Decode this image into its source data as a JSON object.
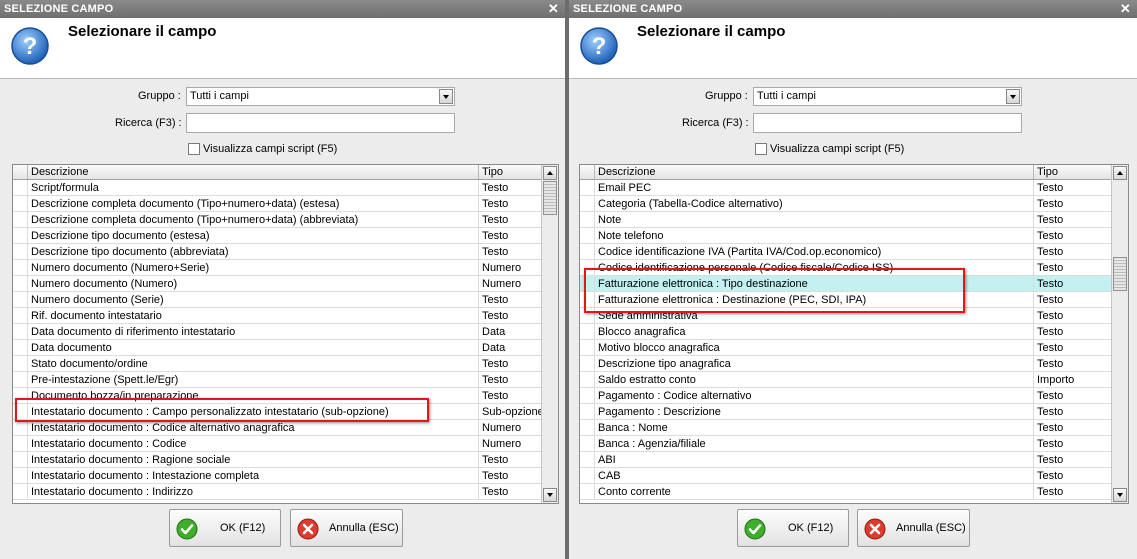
{
  "dialog_left": {
    "title": "SELEZIONE CAMPO",
    "heading": "Selezionare il campo",
    "gruppo_label": "Gruppo :",
    "gruppo_value": "Tutti i campi",
    "ricerca_label": "Ricerca (F3) :",
    "ricerca_value": "",
    "script_checkbox_label": "Visualizza campi script (F5)",
    "columns": {
      "descrizione": "Descrizione",
      "tipo": "Tipo"
    },
    "rows": [
      {
        "d": "Script/formula",
        "t": "Testo"
      },
      {
        "d": "Descrizione completa documento (Tipo+numero+data) (estesa)",
        "t": "Testo"
      },
      {
        "d": "Descrizione completa documento (Tipo+numero+data) (abbreviata)",
        "t": "Testo"
      },
      {
        "d": "Descrizione tipo documento (estesa)",
        "t": "Testo"
      },
      {
        "d": "Descrizione tipo documento (abbreviata)",
        "t": "Testo"
      },
      {
        "d": "Numero documento (Numero+Serie)",
        "t": "Numero"
      },
      {
        "d": "Numero documento (Numero)",
        "t": "Numero"
      },
      {
        "d": "Numero documento (Serie)",
        "t": "Testo"
      },
      {
        "d": "Rif. documento intestatario",
        "t": "Testo"
      },
      {
        "d": "Data documento di riferimento intestatario",
        "t": "Data"
      },
      {
        "d": "Data documento",
        "t": "Data"
      },
      {
        "d": "Stato documento/ordine",
        "t": "Testo"
      },
      {
        "d": "Pre-intestazione (Spett.le/Egr)",
        "t": "Testo"
      },
      {
        "d": "Documento bozza/in preparazione",
        "t": "Testo"
      },
      {
        "d": "Intestatario documento : Campo personalizzato intestatario (sub-opzione)",
        "t": "Sub-opzione"
      },
      {
        "d": "Intestatario documento : Codice alternativo anagrafica",
        "t": "Numero"
      },
      {
        "d": "Intestatario documento : Codice",
        "t": "Numero"
      },
      {
        "d": "Intestatario documento : Ragione sociale",
        "t": "Testo"
      },
      {
        "d": "Intestatario documento : Intestazione completa",
        "t": "Testo"
      },
      {
        "d": "Intestatario documento : Indirizzo",
        "t": "Testo"
      }
    ],
    "ok_label": "OK (F12)",
    "cancel_label": "Annulla (ESC)"
  },
  "dialog_right": {
    "title": "SELEZIONE CAMPO",
    "heading": "Selezionare il campo",
    "gruppo_label": "Gruppo :",
    "gruppo_value": "Tutti i campi",
    "ricerca_label": "Ricerca (F3) :",
    "ricerca_value": "",
    "script_checkbox_label": "Visualizza campi script (F5)",
    "columns": {
      "descrizione": "Descrizione",
      "tipo": "Tipo"
    },
    "rows": [
      {
        "d": "Email PEC",
        "t": "Testo"
      },
      {
        "d": "Categoria (Tabella-Codice alternativo)",
        "t": "Testo"
      },
      {
        "d": "Note",
        "t": "Testo"
      },
      {
        "d": "Note telefono",
        "t": "Testo"
      },
      {
        "d": "Codice identificazione IVA (Partita IVA/Cod.op.economico)",
        "t": "Testo"
      },
      {
        "d": "Codice identificazione personale (Codice fiscale/Codice ISS)",
        "t": "Testo"
      },
      {
        "d": "Fatturazione elettronica : Tipo destinazione",
        "t": "Testo"
      },
      {
        "d": "Fatturazione elettronica : Destinazione (PEC, SDI, IPA)",
        "t": "Testo"
      },
      {
        "d": "Sede amministrativa",
        "t": "Testo"
      },
      {
        "d": "Blocco anagrafica",
        "t": "Testo"
      },
      {
        "d": "Motivo blocco anagrafica",
        "t": "Testo"
      },
      {
        "d": "Descrizione tipo anagrafica",
        "t": "Testo"
      },
      {
        "d": "Saldo estratto conto",
        "t": "Importo"
      },
      {
        "d": "Pagamento : Codice alternativo",
        "t": "Testo"
      },
      {
        "d": "Pagamento : Descrizione",
        "t": "Testo"
      },
      {
        "d": "Banca : Nome",
        "t": "Testo"
      },
      {
        "d": "Banca : Agenzia/filiale",
        "t": "Testo"
      },
      {
        "d": "ABI",
        "t": "Testo"
      },
      {
        "d": "CAB",
        "t": "Testo"
      },
      {
        "d": "Conto corrente",
        "t": "Testo"
      }
    ],
    "selected_row": "Fatturazione elettronica : Tipo destinazione",
    "ok_label": "OK (F12)",
    "cancel_label": "Annulla (ESC)"
  },
  "icons": {
    "help": "help-question-icon",
    "ok": "green-check-icon",
    "cancel": "red-x-icon",
    "close": "close-icon"
  },
  "colors": {
    "highlight_box": "#e01818",
    "selected_row": "#c3f0f0",
    "titlebar": "#7a7a7a"
  }
}
